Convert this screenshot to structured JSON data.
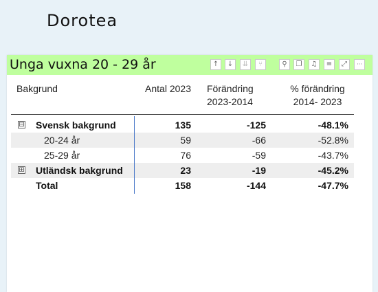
{
  "page": {
    "title": "Dorotea"
  },
  "visual": {
    "title": "Unga vuxna 20 - 29 år",
    "header_color": "#bfff9e",
    "toolbar": [
      {
        "icon": "drill-up-icon",
        "glyph": "↑"
      },
      {
        "icon": "drill-down-icon",
        "glyph": "↓"
      },
      {
        "icon": "expand-all-down-icon",
        "glyph": "⇊"
      },
      {
        "icon": "expand-hierarchy-icon",
        "glyph": "⑂"
      },
      {
        "icon": "pin-icon",
        "glyph": "⚲"
      },
      {
        "icon": "copy-icon",
        "glyph": "❐"
      },
      {
        "icon": "alert-bell-icon",
        "glyph": "♫"
      },
      {
        "icon": "filter-icon",
        "glyph": "≡"
      },
      {
        "icon": "focus-mode-icon",
        "glyph": "⤢"
      },
      {
        "icon": "more-options-icon",
        "glyph": "···"
      }
    ]
  },
  "table": {
    "headers": {
      "bakgrund": "Bakgrund",
      "antal": "Antal 2023",
      "forandring_l1": "Förändring",
      "forandring_l2": "2023-2014",
      "pct_l1": "% förändring",
      "pct_l2": "2014- 2023"
    },
    "rows": [
      {
        "label": "Svensk bakgrund",
        "antal": "135",
        "forandring": "-125",
        "pct": "-48.1%",
        "expander": "⊟"
      },
      {
        "label": "20-24 år",
        "antal": "59",
        "forandring": "-66",
        "pct": "-52.8%"
      },
      {
        "label": "25-29 år",
        "antal": "76",
        "forandring": "-59",
        "pct": "-43.7%"
      },
      {
        "label": "Utländsk bakgrund",
        "antal": "23",
        "forandring": "-19",
        "pct": "-45.2%",
        "expander": "⊞"
      },
      {
        "label": "Total",
        "antal": "158",
        "forandring": "-144",
        "pct": "-47.7%"
      }
    ]
  }
}
